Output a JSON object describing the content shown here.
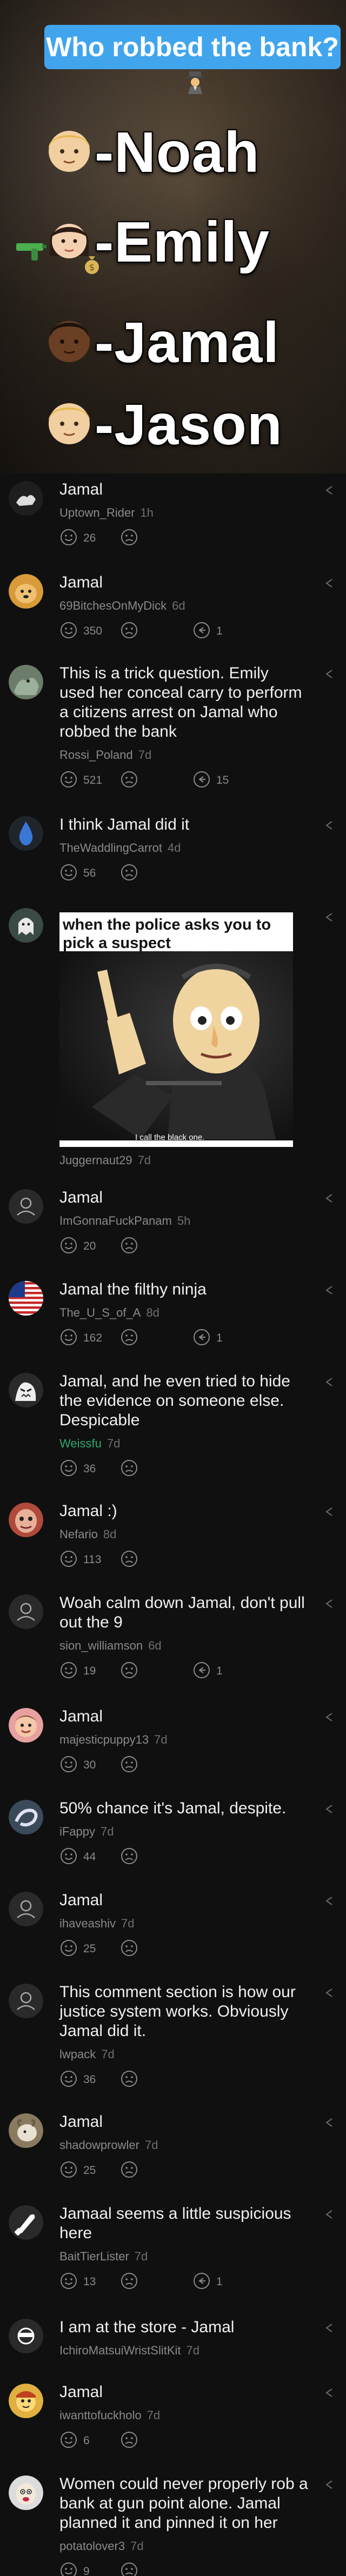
{
  "video_overlay": {
    "question": "Who robbed the bank?",
    "suspects": [
      {
        "name": "-Noah",
        "face": "light-skin-blond-boy-icon"
      },
      {
        "name": "-Emily",
        "face": "woman-with-money-and-gun-icon"
      },
      {
        "name": "-Jamal",
        "face": "dark-skin-boy-icon"
      },
      {
        "name": "-Jason",
        "face": "light-skin-blond-boy-icon"
      }
    ]
  },
  "colors": {
    "background": "#101010",
    "accent_blue": "#41a5ee",
    "username_gray": "#8a8a8a",
    "text": "#f0f0f0",
    "green_user": "#2fa870"
  },
  "comments": [
    {
      "text": "Jamal",
      "user": "Uptown_Rider",
      "time": "1h",
      "likes": "26",
      "replies": ""
    },
    {
      "text": "Jamal",
      "user": "69BitchesOnMyDick",
      "time": "6d",
      "likes": "350",
      "replies": "1"
    },
    {
      "text": "This is a trick question. Emily used her conceal carry to perform a citizens arrest on Jamal who robbed the bank",
      "user": "Rossi_Poland",
      "time": "7d",
      "likes": "521",
      "replies": "15"
    },
    {
      "text": "I think Jamal did it",
      "user": "TheWaddlingCarrot",
      "time": "4d",
      "likes": "56",
      "replies": ""
    },
    {
      "text": "",
      "user": "Juggernaut29",
      "time": "7d",
      "likes": "",
      "replies": "",
      "meme": {
        "caption": "when the police asks you to pick a suspect",
        "bottom": "I call the black one."
      }
    },
    {
      "text": "Jamal",
      "user": "ImGonnaFuckPanam",
      "time": "5h",
      "likes": "20",
      "replies": ""
    },
    {
      "text": "Jamal the filthy ninja",
      "user": "The_U_S_of_A",
      "time": "8d",
      "likes": "162",
      "replies": "1"
    },
    {
      "text": "Jamal, and he even tried to hide the evidence on someone else. Despicable",
      "user": "Weissfu",
      "time": "7d",
      "likes": "36",
      "replies": ""
    },
    {
      "text": "Jamal :)",
      "user": "Nefario",
      "time": "8d",
      "likes": "113",
      "replies": ""
    },
    {
      "text": "Woah calm down Jamal, don't pull out the 9",
      "user": "sion_williamson",
      "time": "6d",
      "likes": "19",
      "replies": "1"
    },
    {
      "text": "Jamal",
      "user": "majesticpuppy13",
      "time": "7d",
      "likes": "30",
      "replies": ""
    },
    {
      "text": "50% chance it's Jamal, despite.",
      "user": "iFappy",
      "time": "7d",
      "likes": "44",
      "replies": ""
    },
    {
      "text": "Jamal",
      "user": "ihaveashiv",
      "time": "7d",
      "likes": "25",
      "replies": ""
    },
    {
      "text": "This comment section is how our justice system works. Obviously Jamal did it.",
      "user": "lwpack",
      "time": "7d",
      "likes": "36",
      "replies": ""
    },
    {
      "text": "Jamal",
      "user": "shadowprowler",
      "time": "7d",
      "likes": "25",
      "replies": ""
    },
    {
      "text": "Jamaal seems a little suspicious here",
      "user": "BaitTierLister",
      "time": "7d",
      "likes": "13",
      "replies": "1"
    },
    {
      "text": "I am at the store - Jamal",
      "user": "IchiroMatsuiWristSlitKit",
      "time": "7d",
      "likes": "",
      "replies": ""
    },
    {
      "text": "Jamal",
      "user": "iwanttofuckholo",
      "time": "7d",
      "likes": "6",
      "replies": ""
    },
    {
      "text": "Women could never properly rob a bank at gun point alone. Jamal planned it and pinned it on her",
      "user": "potatolover3",
      "time": "7d",
      "likes": "9",
      "replies": ""
    }
  ]
}
